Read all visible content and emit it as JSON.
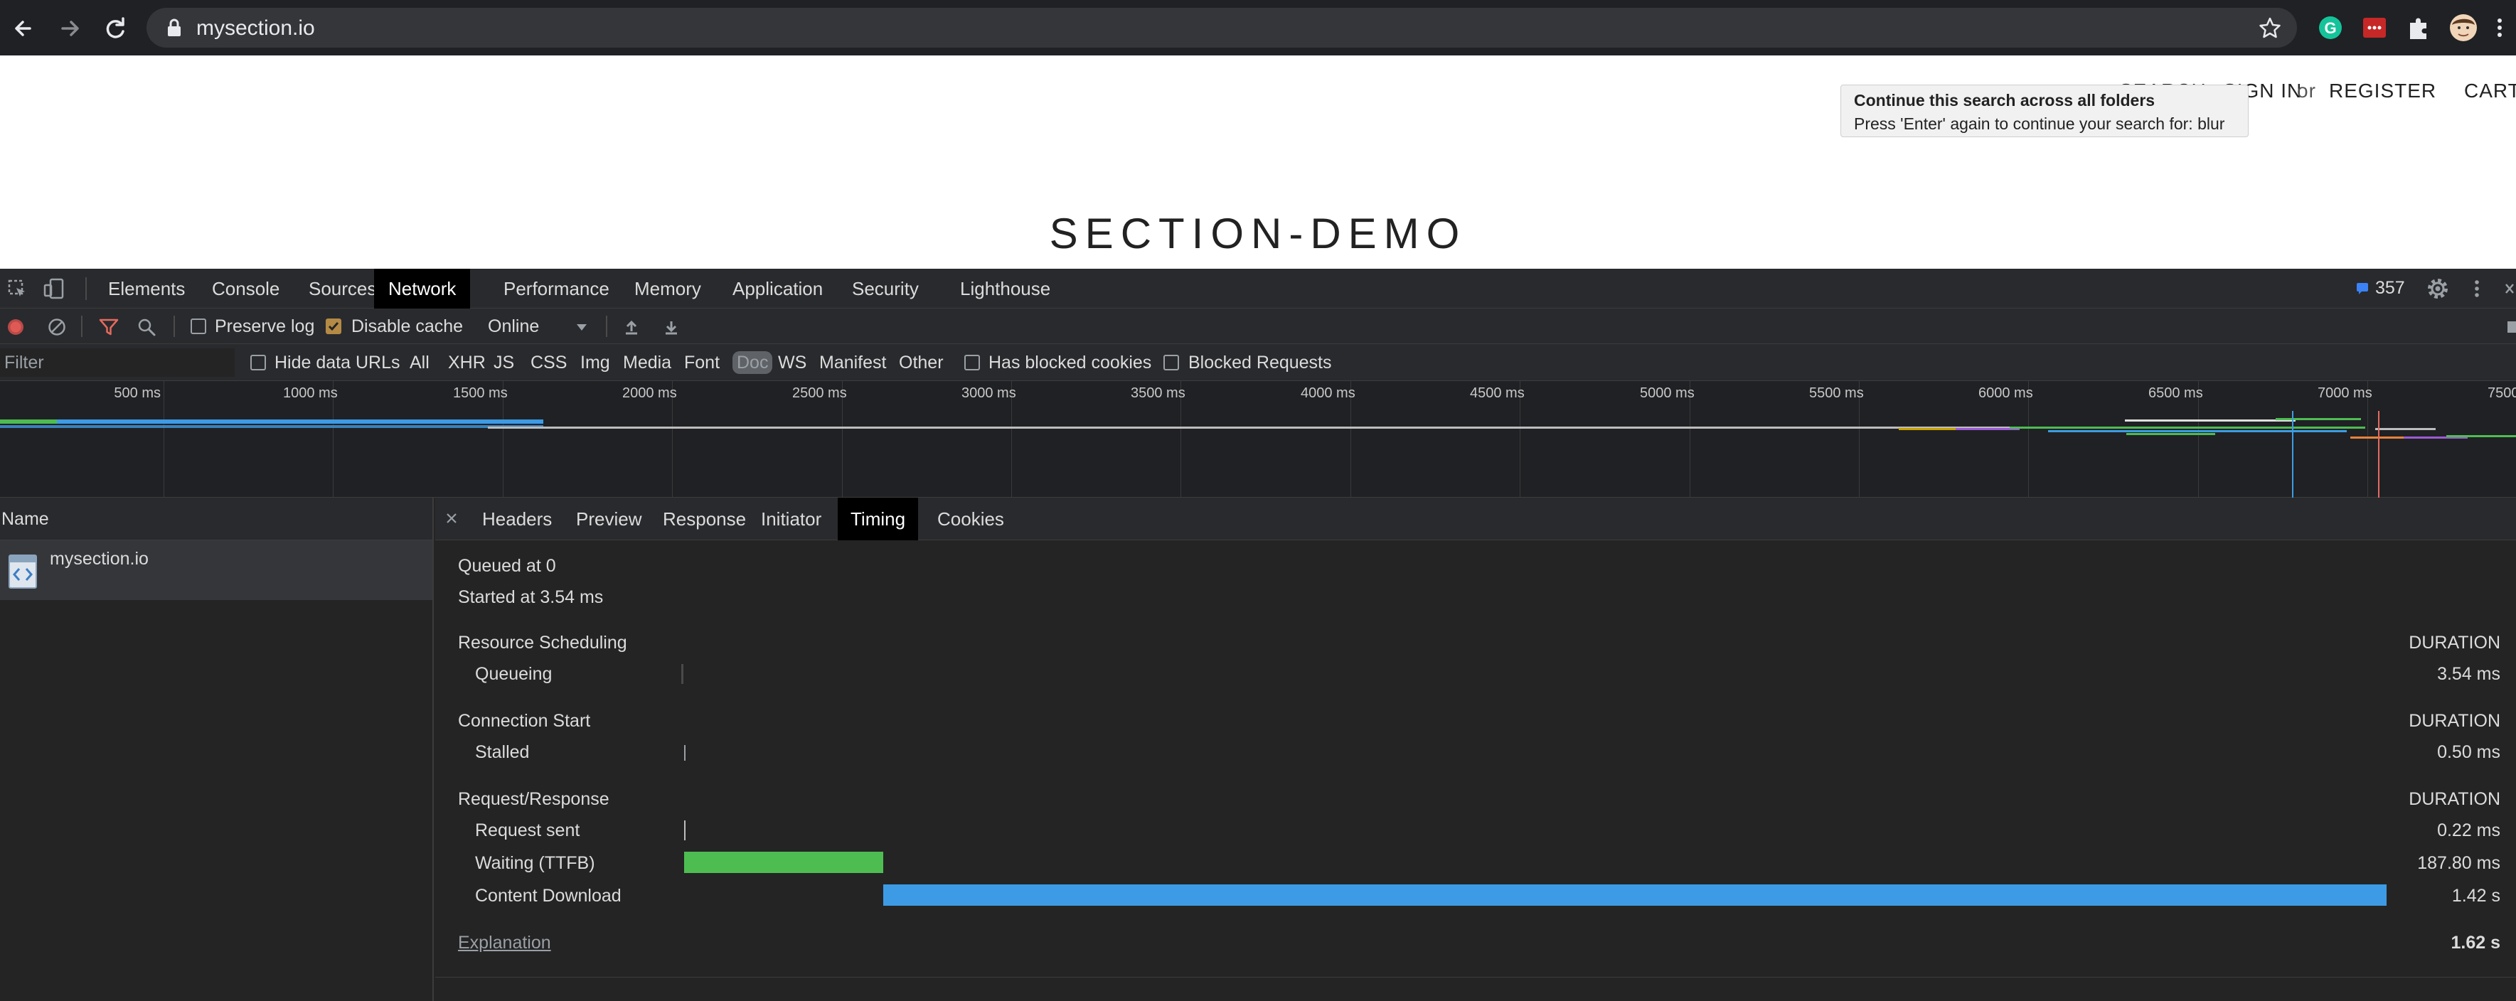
{
  "browser": {
    "url": "mysection.io",
    "icons": [
      "back-icon",
      "forward-icon",
      "reload-icon",
      "lock-icon",
      "star-icon",
      "grammarly-icon",
      "extension-red-icon",
      "puzzle-icon",
      "avatar",
      "more-icon"
    ]
  },
  "page": {
    "nav": {
      "search": "SEARCH",
      "sign_in": "SIGN IN",
      "or": "or",
      "register": "REGISTER",
      "cart": "CART"
    },
    "tooltip": {
      "title": "Continue this search across all folders",
      "body": "Press 'Enter' again to continue your search for: blur"
    },
    "site_title": "SECTION-DEMO"
  },
  "devtools": {
    "tabs": [
      "Elements",
      "Console",
      "Sources",
      "Network",
      "Performance",
      "Memory",
      "Application",
      "Security",
      "Lighthouse"
    ],
    "active_tab": "Network",
    "message_count": "357",
    "toolbar": {
      "preserve_log": "Preserve log",
      "disable_cache": "Disable cache",
      "throttle": "Online"
    },
    "filterbar": {
      "filter_placeholder": "Filter",
      "hide_data_urls": "Hide data URLs",
      "types": [
        "All",
        "XHR",
        "JS",
        "CSS",
        "Img",
        "Media",
        "Font",
        "Doc",
        "WS",
        "Manifest",
        "Other"
      ],
      "active_type": "Doc",
      "has_blocked_cookies": "Has blocked cookies",
      "blocked_requests": "Blocked Requests"
    },
    "overview": {
      "ticks": [
        "500 ms",
        "1000 ms",
        "1500 ms",
        "2000 ms",
        "2500 ms",
        "3000 ms",
        "3500 ms",
        "4000 ms",
        "4500 ms",
        "5000 ms",
        "5500 ms",
        "6000 ms",
        "6500 ms",
        "7000 ms",
        "7500 ms"
      ]
    },
    "requests": {
      "header": "Name",
      "items": [
        {
          "name": "mysection.io"
        }
      ]
    },
    "detail_tabs": [
      "Headers",
      "Preview",
      "Response",
      "Initiator",
      "Timing",
      "Cookies"
    ],
    "active_detail_tab": "Timing",
    "timing": {
      "queued_at": "Queued at 0",
      "started_at": "Started at 3.54 ms",
      "duration_label": "DURATION",
      "sections": [
        {
          "title": "Resource Scheduling",
          "rows": [
            {
              "label": "Queueing",
              "value": "3.54 ms"
            }
          ]
        },
        {
          "title": "Connection Start",
          "rows": [
            {
              "label": "Stalled",
              "value": "0.50 ms"
            }
          ]
        },
        {
          "title": "Request/Response",
          "rows": [
            {
              "label": "Request sent",
              "value": "0.22 ms"
            },
            {
              "label": "Waiting (TTFB)",
              "value": "187.80 ms"
            },
            {
              "label": "Content Download",
              "value": "1.42 s"
            }
          ]
        }
      ],
      "explanation": "Explanation",
      "total": "1.62 s",
      "colors": {
        "waiting": "#4dbd52",
        "download": "#3d9be5"
      }
    }
  }
}
